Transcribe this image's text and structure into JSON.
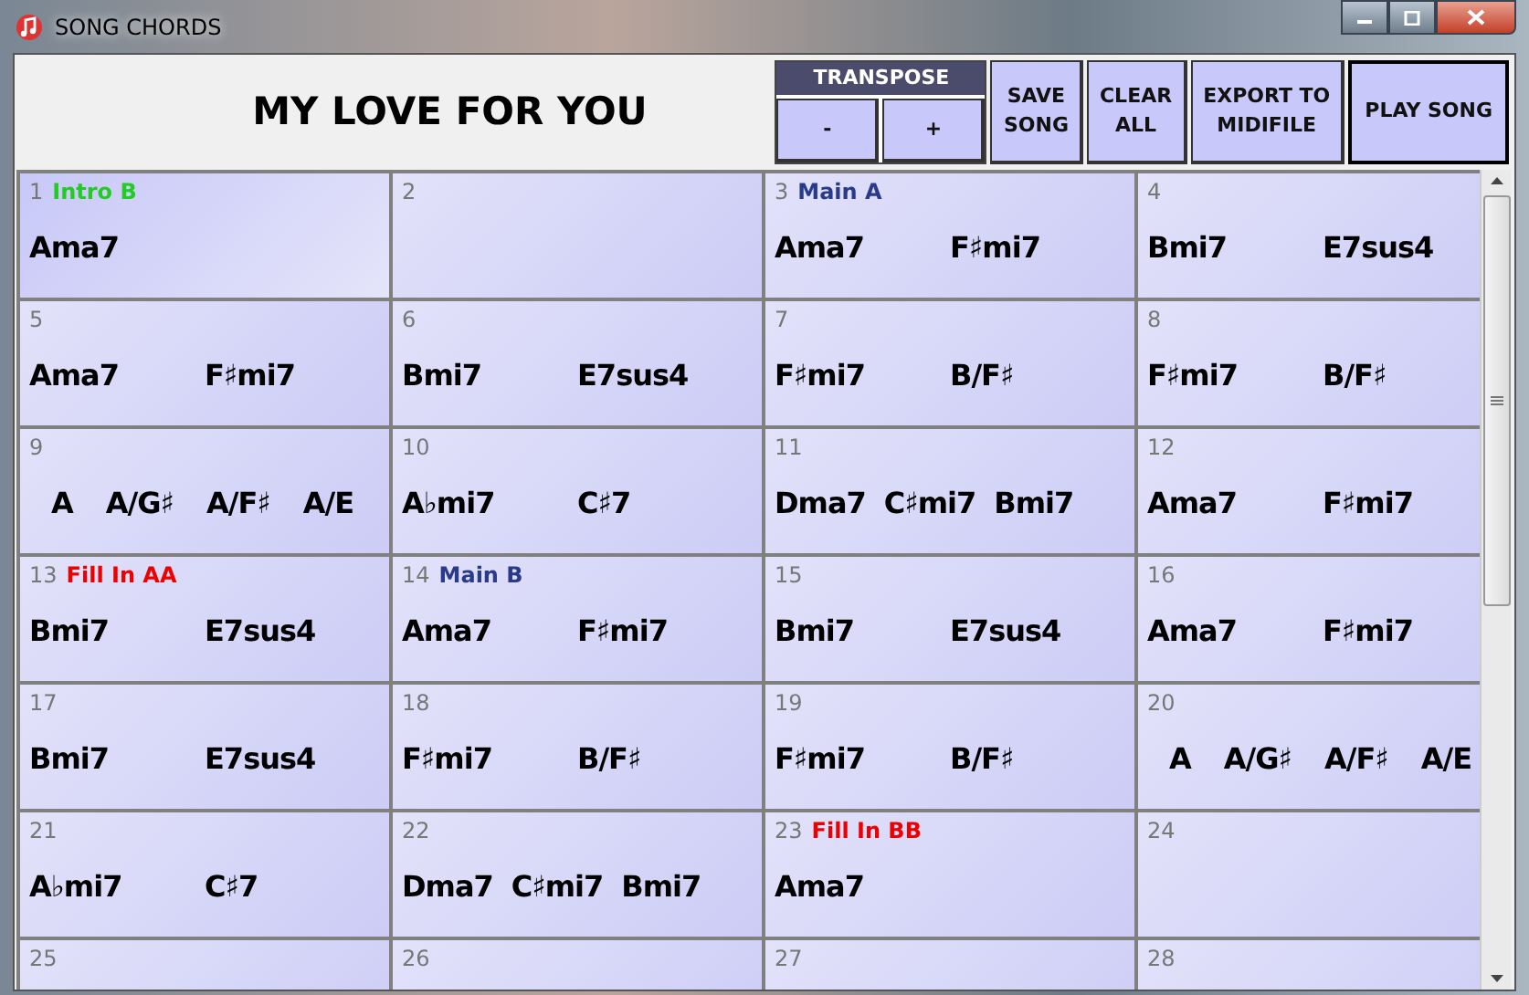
{
  "window": {
    "title": "SONG CHORDS"
  },
  "song_title": "MY LOVE FOR YOU",
  "transpose": {
    "label": "TRANSPOSE",
    "buttons": [
      "-",
      "+"
    ]
  },
  "buttons": [
    {
      "label": "SAVE\nSONG",
      "kind": "normal"
    },
    {
      "label": "CLEAR\nALL",
      "kind": "normal"
    },
    {
      "label": "EXPORT TO\nMIDIFILE",
      "kind": "normal"
    },
    {
      "label": "PLAY SONG",
      "kind": "default"
    }
  ],
  "bars": [
    {
      "number": "1",
      "section": {
        "label": "Intro B",
        "color": "#22cc22"
      },
      "chords": [
        "Ama7"
      ]
    },
    {
      "number": "2"
    },
    {
      "number": "3",
      "section": {
        "label": "Main A",
        "color": "#2a3a8a"
      },
      "chords": [
        "Ama7",
        "F♯mi7"
      ]
    },
    {
      "number": "4",
      "chords": [
        "Bmi7",
        "E7sus4"
      ]
    },
    {
      "number": "5",
      "chords": [
        "Ama7",
        "F♯mi7"
      ]
    },
    {
      "number": "6",
      "chords": [
        "Bmi7",
        "E7sus4"
      ]
    },
    {
      "number": "7",
      "chords": [
        "F♯mi7",
        "B/F♯"
      ]
    },
    {
      "number": "8",
      "chords": [
        "F♯mi7",
        "B/F♯"
      ]
    },
    {
      "number": "9",
      "chords": [
        "A",
        "A/G♯",
        "A/F♯",
        "A/E"
      ]
    },
    {
      "number": "10",
      "chords": [
        "A♭mi7",
        "C♯7"
      ]
    },
    {
      "number": "11",
      "chords": [
        "Dma7",
        "C♯mi7",
        "Bmi7"
      ]
    },
    {
      "number": "12",
      "chords": [
        "Ama7",
        "F♯mi7"
      ]
    },
    {
      "number": "13",
      "section": {
        "label": "Fill In AA",
        "color": "#ee0000"
      },
      "chords": [
        "Bmi7",
        "E7sus4"
      ]
    },
    {
      "number": "14",
      "section": {
        "label": "Main B",
        "color": "#2a3a8a"
      },
      "chords": [
        "Ama7",
        "F♯mi7"
      ]
    },
    {
      "number": "15",
      "chords": [
        "Bmi7",
        "E7sus4"
      ]
    },
    {
      "number": "16",
      "chords": [
        "Ama7",
        "F♯mi7"
      ]
    },
    {
      "number": "17",
      "chords": [
        "Bmi7",
        "E7sus4"
      ]
    },
    {
      "number": "18",
      "chords": [
        "F♯mi7",
        "B/F♯"
      ]
    },
    {
      "number": "19",
      "chords": [
        "F♯mi7",
        "B/F♯"
      ]
    },
    {
      "number": "20",
      "chords": [
        "A",
        "A/G♯",
        "A/F♯",
        "A/E"
      ]
    },
    {
      "number": "21",
      "chords": [
        "A♭mi7",
        "C♯7"
      ]
    },
    {
      "number": "22",
      "chords": [
        "Dma7",
        "C♯mi7",
        "Bmi7"
      ]
    },
    {
      "number": "23",
      "section": {
        "label": "Fill In BB",
        "color": "#ee0000"
      },
      "chords": [
        "Ama7"
      ]
    },
    {
      "number": "24"
    },
    {
      "number": "25"
    },
    {
      "number": "26"
    },
    {
      "number": "27"
    },
    {
      "number": "28"
    }
  ]
}
